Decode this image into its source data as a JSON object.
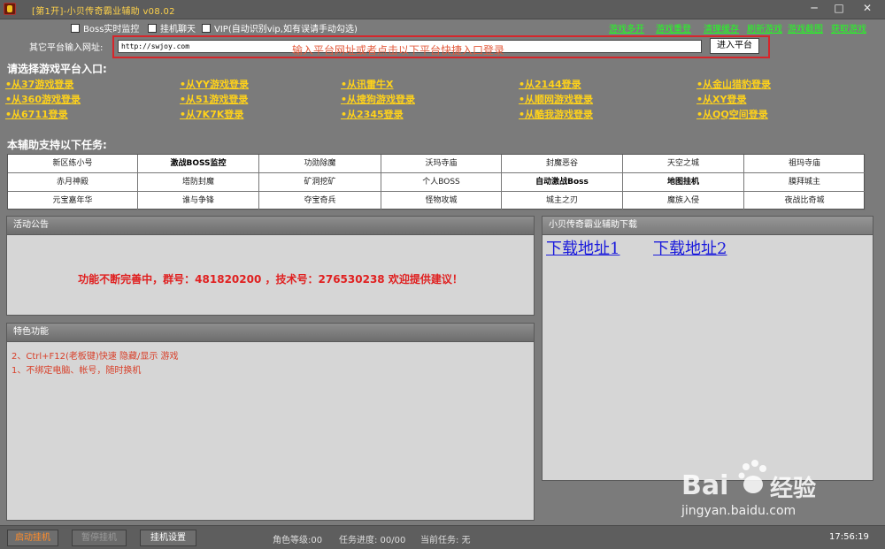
{
  "window": {
    "title": "[第1开]-小贝传奇霸业辅助 v08.02",
    "min_glyph": "─",
    "max_glyph": "□",
    "close_glyph": "✕"
  },
  "options": [
    {
      "label": "Boss实时监控"
    },
    {
      "label": "挂机聊天"
    },
    {
      "label": "VIP(自动识别vip,如有误请手动勾选)"
    }
  ],
  "top_links": [
    "游戏多开",
    "游戏重登",
    "清理缓存",
    "刷新游戏",
    "游戏截图",
    "获取游戏"
  ],
  "url_row": {
    "label": "其它平台输入网址:",
    "value": "http://swjoy.com",
    "hint": "输入平台网址或者点击以下平台快捷入口登录",
    "enter_button": "进入平台"
  },
  "platforms": {
    "title": "请选择游戏平台入口:",
    "items": [
      [
        "•从37游戏登录",
        "•从YY游戏登录",
        "•从讯雷牛X",
        "•从2144登录",
        "•从金山猎豹登录"
      ],
      [
        "•从360游戏登录",
        "•从51游戏登录",
        "•从搜狗游戏登录",
        "•从顺网游戏登录",
        "•从XY登录"
      ],
      [
        "•从6711登录",
        "•从7K7K登录",
        "•从2345登录",
        "•从酷我游戏登录",
        "•从QQ空间登录"
      ]
    ]
  },
  "tasks": {
    "title": "本辅助支持以下任务:",
    "rows": [
      [
        "新区练小号",
        "激战BOSS监控",
        "功勋除魔",
        "沃玛寺庙",
        "封魔恶谷",
        "天空之城",
        "祖玛寺庙"
      ],
      [
        "赤月神殿",
        "塔防封魔",
        "矿洞挖矿",
        "个人BOSS",
        "自动激战Boss",
        "地图挂机",
        "膜拜城主"
      ],
      [
        "元宝嘉年华",
        "谁与争锋",
        "夺宝奇兵",
        "怪物攻城",
        "城主之刃",
        "魔族入侵",
        "夜战比奇城"
      ]
    ],
    "bold": [
      "激战BOSS监控",
      "自动激战Boss",
      "地图挂机"
    ]
  },
  "notice_panel": {
    "title": "活动公告",
    "text": "功能不断完善中，群号：481820200 ，技术号：276530238 欢迎提供建议！"
  },
  "features_panel": {
    "title": "特色功能",
    "lines": [
      "2、Ctrl+F12(老板键)快速 隐藏/显示 游戏",
      "1、不绑定电脑、帐号，随时换机"
    ]
  },
  "download_panel": {
    "title": "小贝传奇霸业辅助下载",
    "link1": "下载地址1",
    "link2": "下载地址2"
  },
  "watermark": {
    "brand": "Bai",
    "brand2": "经验",
    "url": "jingyan.baidu.com"
  },
  "statusbar": {
    "start": "启动挂机",
    "pause": "暂停挂机",
    "settings": "挂机设置",
    "level": "角色等级:00",
    "progress": "任务进度: 00/00",
    "current_task": "当前任务: 无",
    "time": "17:56:19"
  }
}
